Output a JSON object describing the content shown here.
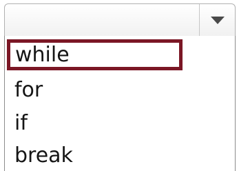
{
  "combo": {
    "selected_value": "",
    "dropdown_icon": "chevron-down-icon"
  },
  "dropdown": {
    "options": [
      "while",
      "for",
      "if",
      "break"
    ],
    "highlighted_index": 0
  },
  "colors": {
    "highlight_border": "#7b1725",
    "text": "#151515"
  }
}
